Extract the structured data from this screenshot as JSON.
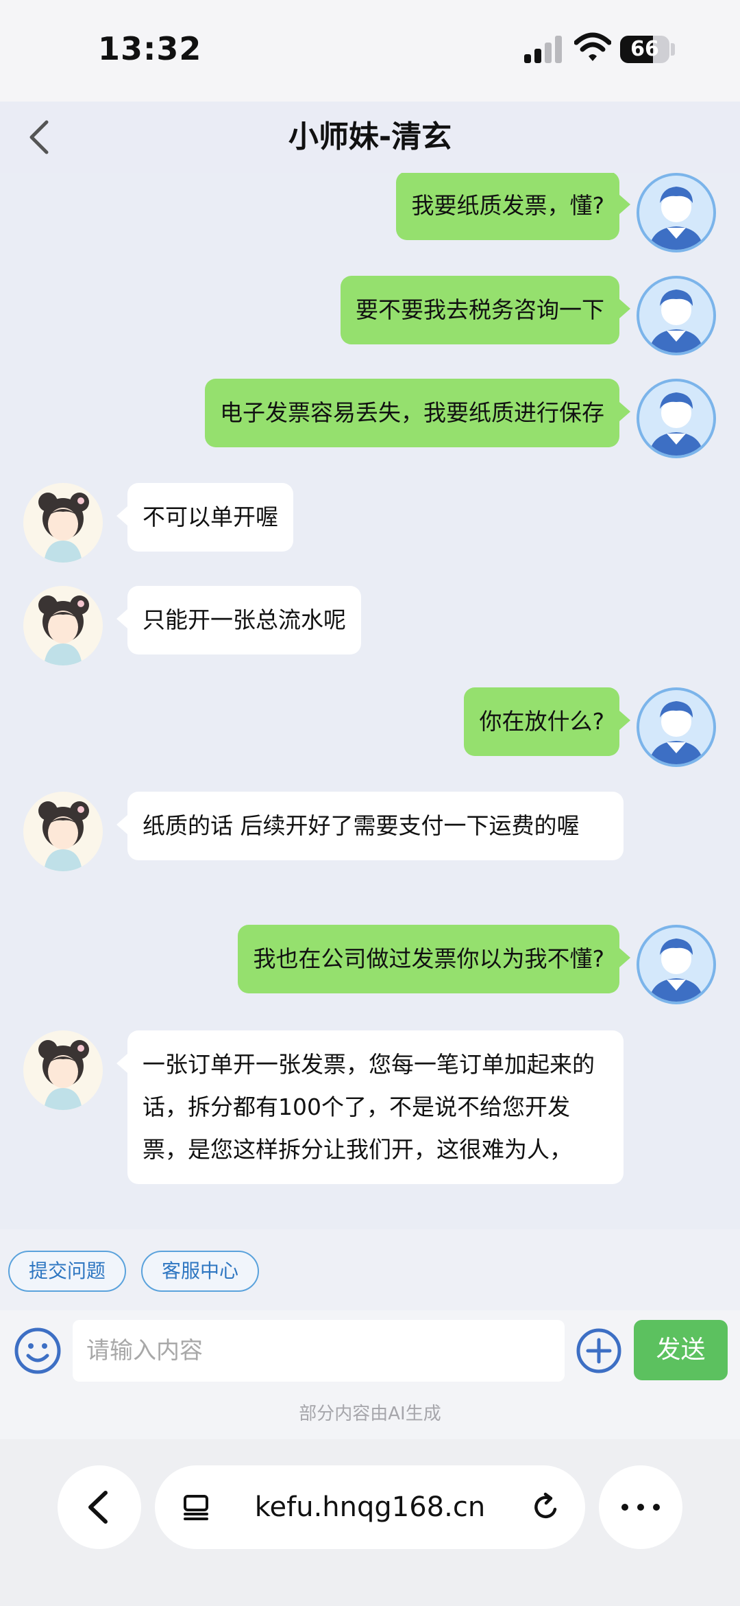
{
  "status_bar": {
    "time": "13:32",
    "battery": "66",
    "battery_level": 0.66
  },
  "header": {
    "title": "小师妹-清玄"
  },
  "messages": [
    {
      "from": "user",
      "text": "我要纸质发票，懂?"
    },
    {
      "from": "user",
      "text": "要不要我去税务咨询一下"
    },
    {
      "from": "user",
      "text": "电子发票容易丢失，我要纸质进行保存"
    },
    {
      "from": "bot",
      "text": "不可以单开喔"
    },
    {
      "from": "bot",
      "text": "只能开一张总流水呢"
    },
    {
      "from": "user",
      "text": "你在放什么?"
    },
    {
      "from": "bot",
      "text": "纸质的话 后续开好了需要支付一下运费的喔"
    },
    {
      "from": "user",
      "text": "我也在公司做过发票你以为我不懂?"
    },
    {
      "from": "bot",
      "text": "一张订单开一张发票，您每一笔订单加起来的话，拆分都有100个了，不是说不给您开发票，是您这样拆分让我们开，这很难为人，"
    }
  ],
  "quick_actions": [
    "提交问题",
    "客服中心"
  ],
  "input": {
    "placeholder": "请输入内容",
    "value": "",
    "send_label": "发送"
  },
  "ai_note": "部分内容由AI生成",
  "browser": {
    "url": "kefu.hnqg168.cn"
  },
  "colors": {
    "user_bubble": "#95e06e",
    "bot_bubble": "#ffffff",
    "send_button": "#5cc15f",
    "chip_border": "#5aa2dc"
  },
  "icons": {
    "back": "chevron-left-icon",
    "emoji": "smiley-icon",
    "plus": "plus-circle-icon",
    "tabs": "tabs-icon",
    "reload": "reload-icon",
    "more": "more-dots-icon"
  }
}
